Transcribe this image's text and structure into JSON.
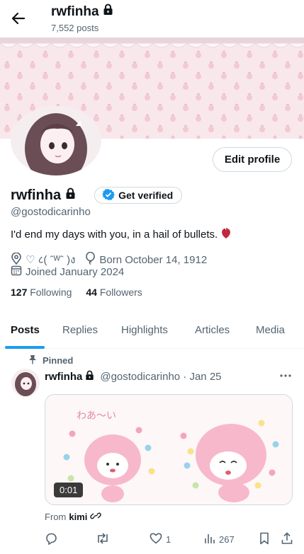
{
  "header": {
    "name": "rwfinha",
    "posts": "7,552 posts"
  },
  "profile": {
    "name": "rwfinha",
    "handle": "@gostodicarinho",
    "edit_label": "Edit profile",
    "verify_label": "Get verified",
    "bio": "I'd end my days with you, in a hail of bullets.",
    "location": "♡ ८( ˆᵂˆ )ง",
    "born": "Born October 14, 1912",
    "joined": "Joined January 2024",
    "following_count": "127",
    "following_label": "Following",
    "followers_count": "44",
    "followers_label": "Followers"
  },
  "tabs": [
    {
      "label": "Posts"
    },
    {
      "label": "Replies"
    },
    {
      "label": "Highlights"
    },
    {
      "label": "Articles"
    },
    {
      "label": "Media"
    }
  ],
  "post": {
    "pinned_label": "Pinned",
    "name": "rwfinha",
    "handle": "@gostodicarinho · Jan 25",
    "media_text": "わあ〜い",
    "duration": "0:01",
    "from_prefix": "From",
    "from_name": "kimi",
    "likes": "1",
    "views": "267"
  },
  "colors": {
    "accent": "#1d9bf0",
    "muted": "#536471",
    "banner": "#f7e9ec",
    "media_bg": "#fbf2f4"
  }
}
